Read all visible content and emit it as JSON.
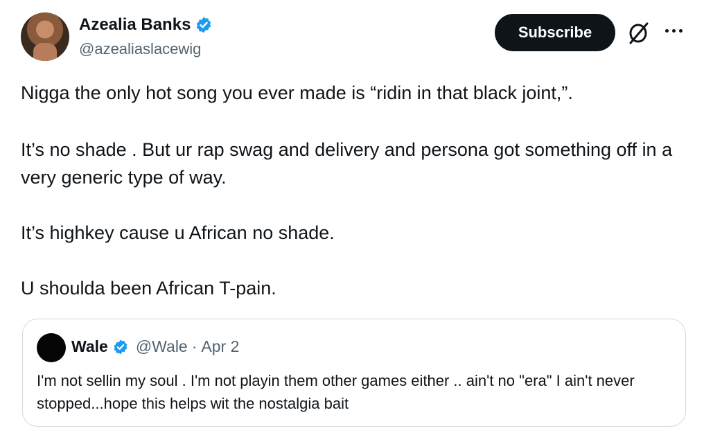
{
  "tweet": {
    "author_name": "Azealia Banks",
    "author_handle": "@azealiaslacewig",
    "subscribe_label": "Subscribe",
    "paragraphs": [
      "Nigga the only hot song you ever made is “ridin in that black joint,”.",
      "It’s no shade . But ur rap swag and delivery and persona got something off in a very generic type of way.",
      "It’s highkey cause u African no shade.",
      "U shoulda been African T-pain."
    ]
  },
  "quote": {
    "author_name": "Wale",
    "author_handle": "@Wale",
    "separator": "·",
    "date": "Apr 2",
    "text": "I'm not sellin my soul . I'm not playin them other games either .. ain't no \"era\" I ain't never stopped...hope this helps wit the nostalgia bait"
  },
  "icons": {
    "verified": "verified-badge-icon",
    "grok": "grok-icon",
    "more": "more-options-icon"
  },
  "colors": {
    "verified_blue": "#1d9bf0",
    "button_bg": "#0f1419",
    "secondary_text": "#536471",
    "border": "#cfd9de"
  }
}
